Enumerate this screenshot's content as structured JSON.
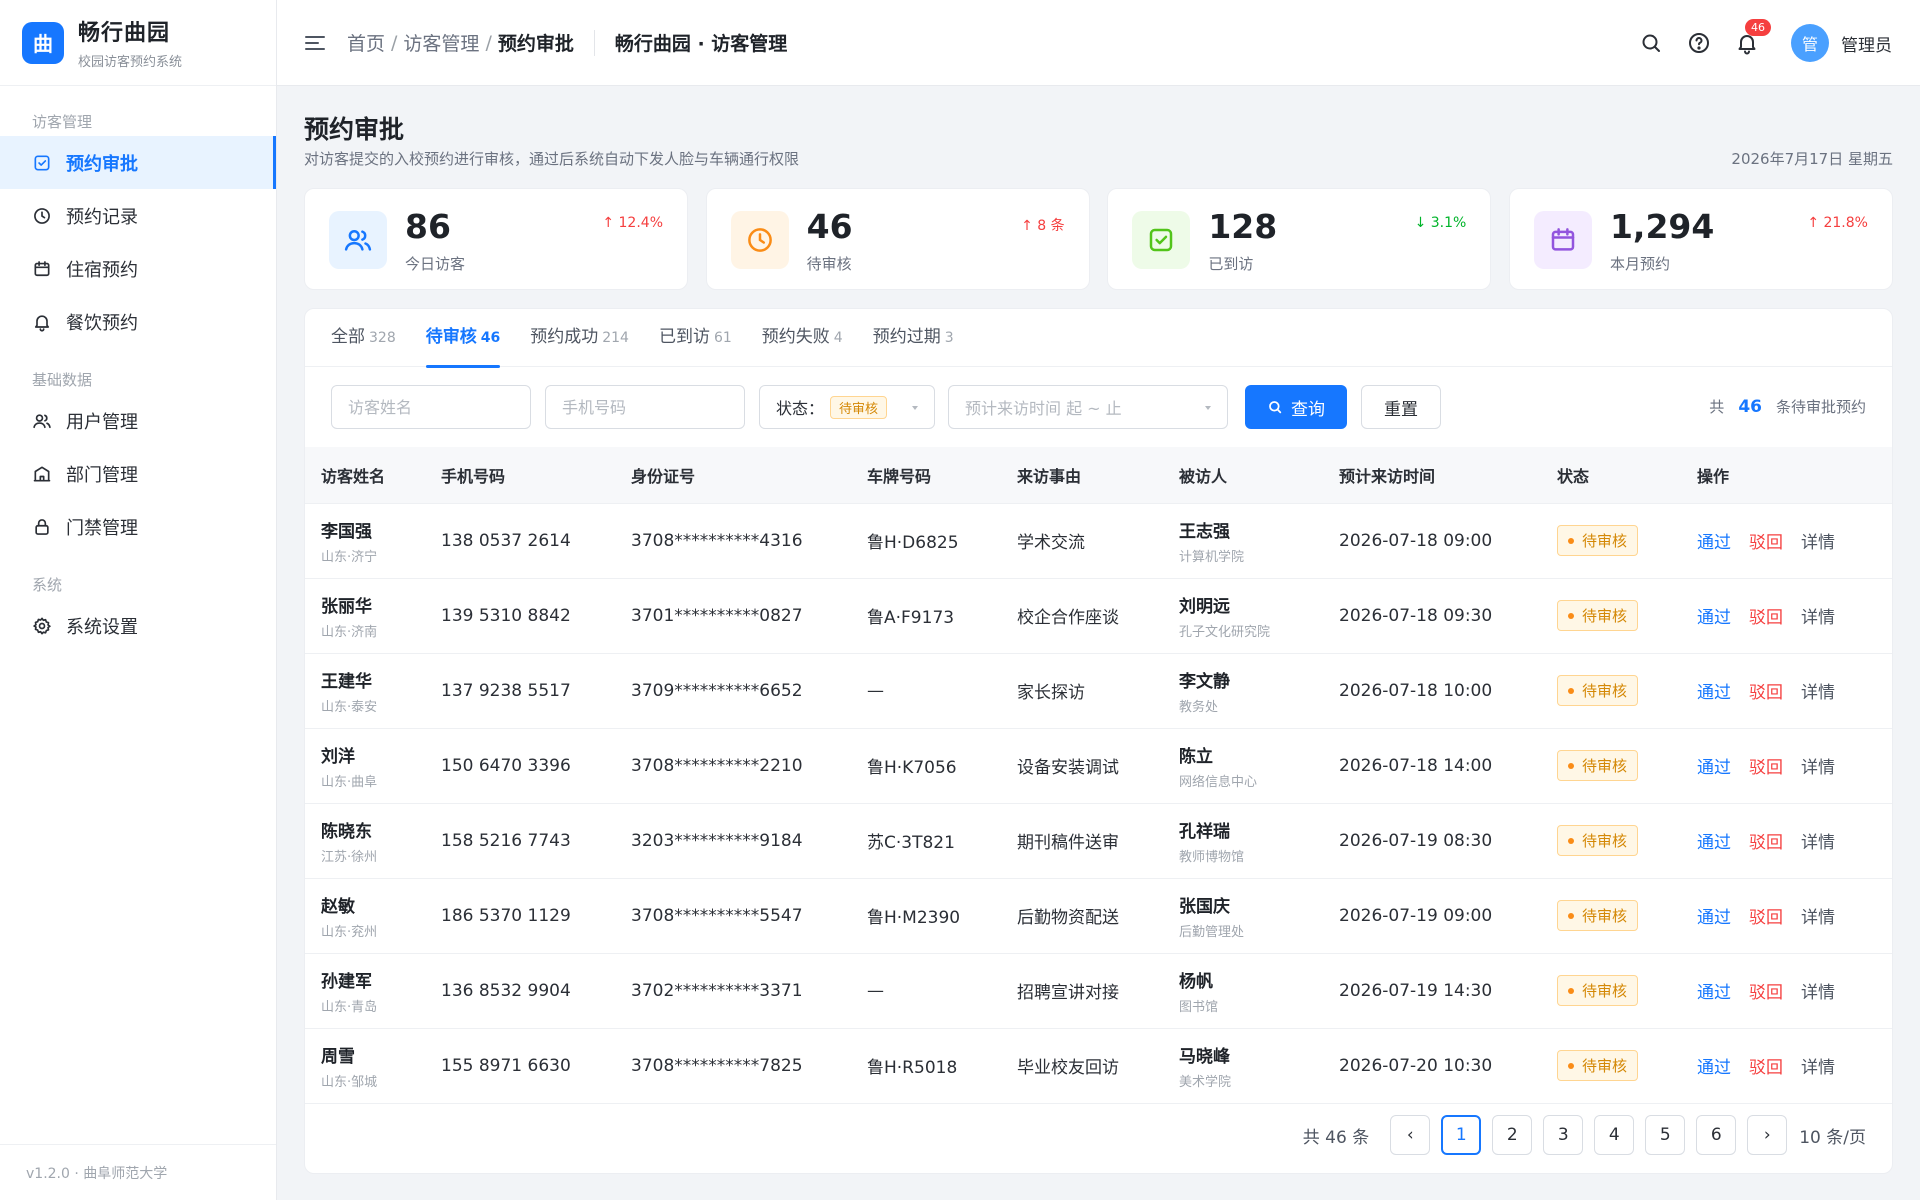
{
  "brand": {
    "logo_char": "曲",
    "name": "畅行曲园",
    "subtitle": "校园访客预约系统"
  },
  "sidebar": {
    "groups": [
      {
        "label": "访客管理",
        "items": [
          {
            "label": "预约审批",
            "icon": "checkbox-icon",
            "active": true
          },
          {
            "label": "预约记录",
            "icon": "clock-icon"
          },
          {
            "label": "住宿预约",
            "icon": "calendar-icon"
          },
          {
            "label": "餐饮预约",
            "icon": "bell-icon"
          }
        ]
      },
      {
        "label": "基础数据",
        "items": [
          {
            "label": "用户管理",
            "icon": "users-icon"
          },
          {
            "label": "部门管理",
            "icon": "building-icon"
          },
          {
            "label": "门禁管理",
            "icon": "lock-icon"
          }
        ]
      },
      {
        "label": "系统",
        "items": [
          {
            "label": "系统设置",
            "icon": "gear-icon"
          }
        ]
      }
    ],
    "footer": "v1.2.0 · 曲阜师范大学"
  },
  "header": {
    "breadcrumb": [
      "首页",
      "访客管理",
      "预约审批"
    ],
    "title": "畅行曲园 · 访客管理",
    "notification_count": "46",
    "avatar_char": "管",
    "user_name": "管理员"
  },
  "page": {
    "title": "预约审批",
    "description": "对访客提交的入校预约进行审核，通过后系统自动下发人脸与车辆通行权限",
    "date": "2026年7月17日 星期五"
  },
  "stats": [
    {
      "value": "86",
      "label": "今日访客",
      "trend": "↑ 12.4%",
      "dir": "up",
      "icon": "users-icon",
      "color": "#1677ff",
      "bg": "#e8f3ff"
    },
    {
      "value": "46",
      "label": "待审核",
      "trend": "↑ 8 条",
      "dir": "up",
      "icon": "clock-icon",
      "color": "#fa8c16",
      "bg": "#fff4e5"
    },
    {
      "value": "128",
      "label": "已到访",
      "trend": "↓ 3.1%",
      "dir": "down",
      "icon": "check-icon",
      "color": "#52c41a",
      "bg": "#eefbe8"
    },
    {
      "value": "1,294",
      "label": "本月预约",
      "trend": "↑ 21.8%",
      "dir": "up",
      "icon": "calendar-icon",
      "color": "#9254de",
      "bg": "#f4ecff"
    }
  ],
  "tabs": [
    {
      "label": "全部",
      "count": "328"
    },
    {
      "label": "待审核",
      "count": "46",
      "active": true
    },
    {
      "label": "预约成功",
      "count": "214"
    },
    {
      "label": "已到访",
      "count": "61"
    },
    {
      "label": "预约失败",
      "count": "4"
    },
    {
      "label": "预约过期",
      "count": "3"
    }
  ],
  "filters": {
    "name_placeholder": "访客姓名",
    "phone_placeholder": "手机号码",
    "status_label": "状态：",
    "status_value": "待审核",
    "date_placeholder": "预计来访时间 起 ~ 止",
    "search_label": "查询",
    "reset_label": "重置",
    "total_prefix": "共",
    "total_count": "46",
    "total_suffix": "条待审批预约"
  },
  "table": {
    "columns": [
      "访客姓名",
      "手机号码",
      "身份证号",
      "车牌号码",
      "来访事由",
      "被访人",
      "预计来访时间",
      "状态",
      "操作"
    ],
    "rows": [
      {
        "name": "李国强",
        "origin": "山东·济宁",
        "phone": "138 0537 2614",
        "id": "3708**********4316",
        "plate": "鲁H·D6825",
        "reason": "学术交流",
        "host": "王志强",
        "dept": "计算机学院",
        "time": "2026-07-18 09:00",
        "status": "待审核"
      },
      {
        "name": "张丽华",
        "origin": "山东·济南",
        "phone": "139 5310 8842",
        "id": "3701**********0827",
        "plate": "鲁A·F9173",
        "reason": "校企合作座谈",
        "host": "刘明远",
        "dept": "孔子文化研究院",
        "time": "2026-07-18 09:30",
        "status": "待审核"
      },
      {
        "name": "王建华",
        "origin": "山东·泰安",
        "phone": "137 9238 5517",
        "id": "3709**********6652",
        "plate": "—",
        "reason": "家长探访",
        "host": "李文静",
        "dept": "教务处",
        "time": "2026-07-18 10:00",
        "status": "待审核"
      },
      {
        "name": "刘洋",
        "origin": "山东·曲阜",
        "phone": "150 6470 3396",
        "id": "3708**********2210",
        "plate": "鲁H·K7056",
        "reason": "设备安装调试",
        "host": "陈立",
        "dept": "网络信息中心",
        "time": "2026-07-18 14:00",
        "status": "待审核"
      },
      {
        "name": "陈晓东",
        "origin": "江苏·徐州",
        "phone": "158 5216 7743",
        "id": "3203**********9184",
        "plate": "苏C·3T821",
        "reason": "期刊稿件送审",
        "host": "孔祥瑞",
        "dept": "教师博物馆",
        "time": "2026-07-19 08:30",
        "status": "待审核"
      },
      {
        "name": "赵敏",
        "origin": "山东·兖州",
        "phone": "186 5370 1129",
        "id": "3708**********5547",
        "plate": "鲁H·M2390",
        "reason": "后勤物资配送",
        "host": "张国庆",
        "dept": "后勤管理处",
        "time": "2026-07-19 09:00",
        "status": "待审核"
      },
      {
        "name": "孙建军",
        "origin": "山东·青岛",
        "phone": "136 8532 9904",
        "id": "3702**********3371",
        "plate": "—",
        "reason": "招聘宣讲对接",
        "host": "杨帆",
        "dept": "图书馆",
        "time": "2026-07-19 14:30",
        "status": "待审核"
      },
      {
        "name": "周雪",
        "origin": "山东·邹城",
        "phone": "155 8971 6630",
        "id": "3708**********7825",
        "plate": "鲁H·R5018",
        "reason": "毕业校友回访",
        "host": "马晓峰",
        "dept": "美术学院",
        "time": "2026-07-20 10:30",
        "status": "待审核"
      }
    ],
    "actions": {
      "pass": "通过",
      "reject": "驳回",
      "detail": "详情"
    }
  },
  "pagination": {
    "total": "共 46 条",
    "prev": "‹",
    "next": "›",
    "pages": [
      "1",
      "2",
      "3",
      "4",
      "5",
      "6"
    ],
    "current": "1",
    "page_size": "10 条/页"
  }
}
